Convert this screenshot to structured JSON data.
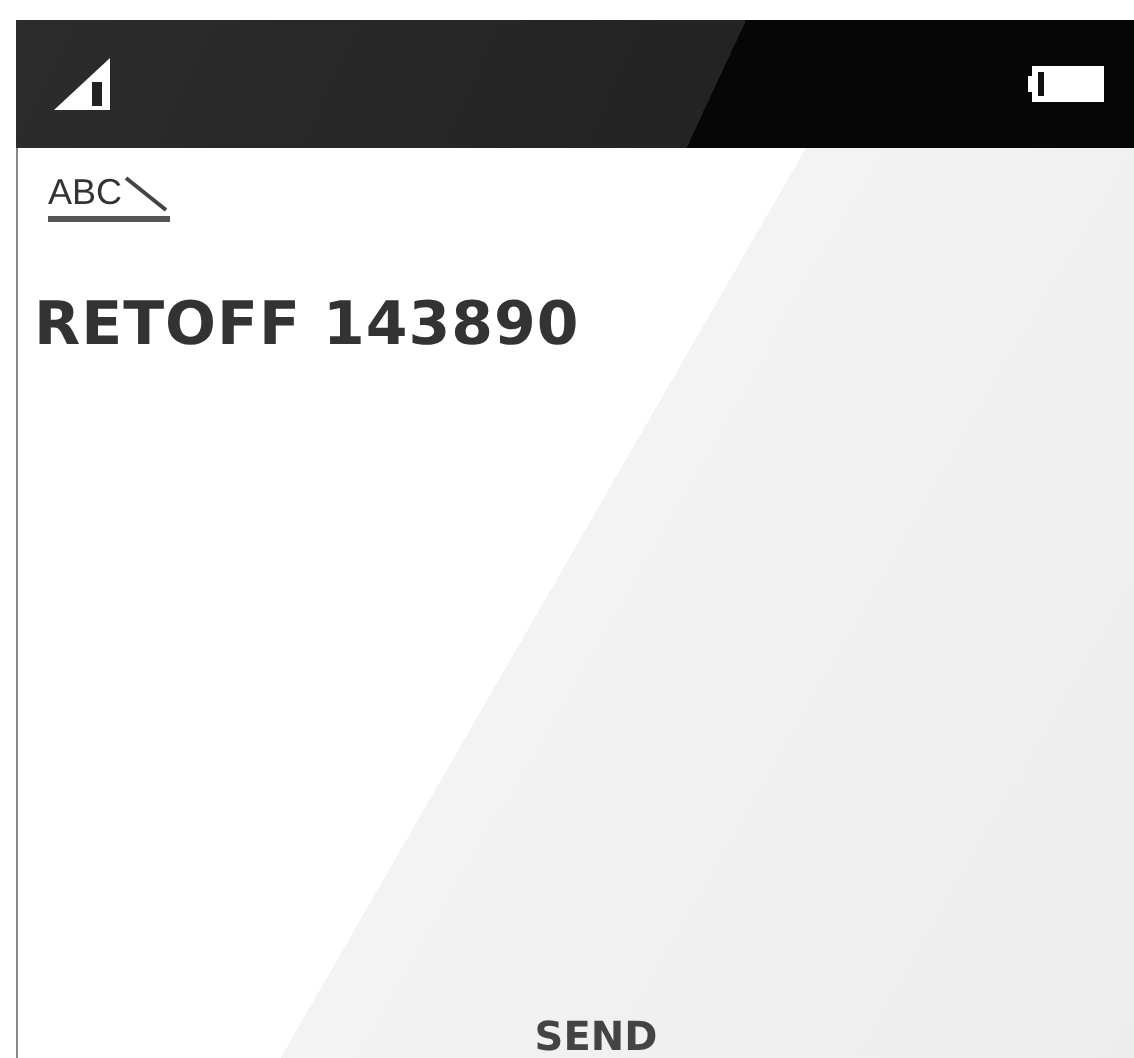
{
  "input_mode": {
    "label": "ABC"
  },
  "message": {
    "value": "RETOFF 143890"
  },
  "softkeys": [
    {
      "label": "SEND"
    }
  ]
}
